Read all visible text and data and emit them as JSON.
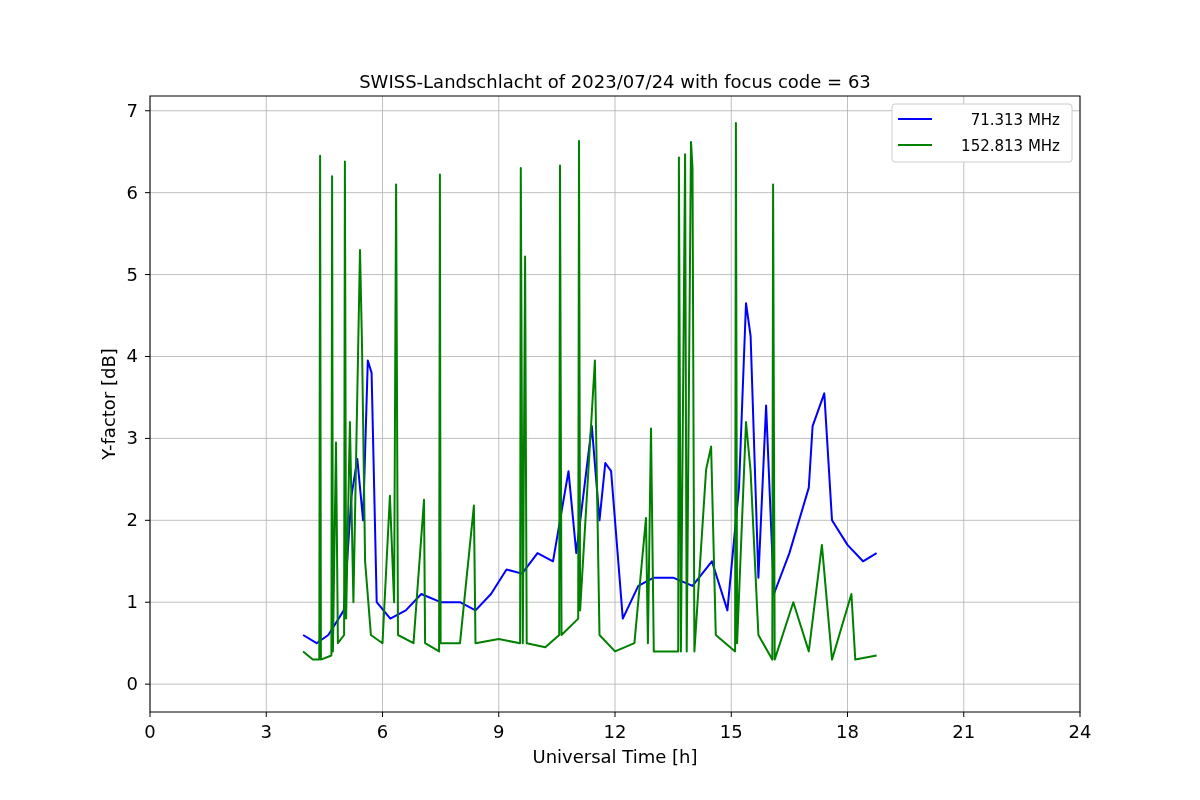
{
  "chart_data": {
    "type": "line",
    "title": "SWISS-Landschlacht of 2023/07/24 with focus code = 63",
    "xlabel": "Universal Time [h]",
    "ylabel": "Y-factor [dB]",
    "xlim": [
      0,
      24
    ],
    "ylim": [
      -0.34,
      7.18
    ],
    "grid": true,
    "xticks": [
      0,
      3,
      6,
      9,
      12,
      15,
      18,
      21,
      24
    ],
    "yticks": [
      0,
      1,
      2,
      3,
      4,
      5,
      6,
      7
    ],
    "series": [
      {
        "name": "71.313 MHz",
        "color": "#0000ff",
        "x": [
          3.95,
          4.3,
          4.6,
          5.0,
          5.2,
          5.35,
          5.5,
          5.62,
          5.72,
          5.85,
          6.2,
          6.6,
          7.0,
          7.5,
          8.0,
          8.4,
          8.8,
          9.2,
          9.6,
          10.0,
          10.4,
          10.8,
          11.0,
          11.4,
          11.6,
          11.75,
          11.9,
          12.2,
          12.6,
          13.0,
          13.5,
          14.0,
          14.5,
          14.9,
          15.2,
          15.38,
          15.5,
          15.7,
          15.9,
          16.1,
          16.5,
          17.0,
          17.1,
          17.4,
          17.6,
          18.0,
          18.4,
          18.75
        ],
        "values": [
          0.6,
          0.5,
          0.6,
          0.9,
          2.3,
          2.75,
          2.0,
          3.95,
          3.8,
          1.0,
          0.8,
          0.9,
          1.1,
          1.0,
          1.0,
          0.9,
          1.1,
          1.4,
          1.35,
          1.6,
          1.5,
          2.6,
          1.6,
          3.15,
          2.0,
          2.7,
          2.6,
          0.8,
          1.2,
          1.3,
          1.3,
          1.2,
          1.5,
          0.9,
          2.4,
          4.65,
          4.25,
          1.3,
          3.4,
          1.1,
          1.6,
          2.4,
          3.15,
          3.55,
          2.0,
          1.7,
          1.5,
          1.6
        ]
      },
      {
        "name": "152.813 MHz",
        "color": "#008000",
        "x": [
          3.95,
          4.2,
          4.37,
          4.39,
          4.41,
          4.68,
          4.7,
          4.72,
          4.8,
          4.85,
          5.01,
          5.03,
          5.06,
          5.16,
          5.25,
          5.42,
          5.47,
          5.55,
          5.7,
          6.0,
          6.19,
          6.3,
          6.35,
          6.4,
          6.8,
          7.07,
          7.1,
          7.46,
          7.48,
          7.5,
          8.0,
          8.36,
          8.4,
          9.0,
          9.55,
          9.57,
          9.62,
          9.68,
          9.72,
          10.2,
          10.56,
          10.58,
          10.62,
          11.05,
          11.07,
          11.1,
          11.48,
          11.6,
          12.0,
          12.5,
          12.8,
          12.85,
          12.93,
          13.0,
          13.63,
          13.65,
          13.7,
          13.81,
          13.85,
          13.96,
          14.0,
          14.05,
          14.35,
          14.48,
          14.6,
          15.1,
          15.12,
          15.15,
          15.38,
          15.5,
          15.7,
          16.06,
          16.08,
          16.12,
          16.6,
          17.0,
          17.34,
          17.6,
          18.1,
          18.2,
          18.75
        ],
        "values": [
          0.4,
          0.3,
          0.3,
          6.45,
          0.3,
          0.35,
          6.2,
          0.4,
          2.95,
          0.5,
          0.6,
          6.38,
          0.8,
          3.2,
          1.0,
          5.3,
          4.15,
          1.5,
          0.6,
          0.5,
          2.3,
          1.0,
          6.1,
          0.6,
          0.5,
          2.25,
          0.5,
          0.4,
          6.22,
          0.5,
          0.5,
          2.18,
          0.5,
          0.55,
          0.5,
          6.3,
          0.5,
          5.22,
          0.5,
          0.45,
          0.6,
          6.33,
          0.6,
          0.8,
          6.63,
          0.9,
          3.95,
          0.6,
          0.4,
          0.5,
          2.03,
          0.5,
          3.12,
          0.4,
          0.4,
          6.43,
          0.4,
          6.47,
          0.4,
          6.62,
          6.3,
          0.4,
          2.62,
          2.9,
          0.6,
          0.4,
          6.85,
          0.5,
          3.2,
          2.6,
          0.6,
          0.3,
          6.1,
          0.3,
          1.0,
          0.4,
          1.7,
          0.3,
          1.1,
          0.3,
          0.35
        ]
      }
    ]
  }
}
